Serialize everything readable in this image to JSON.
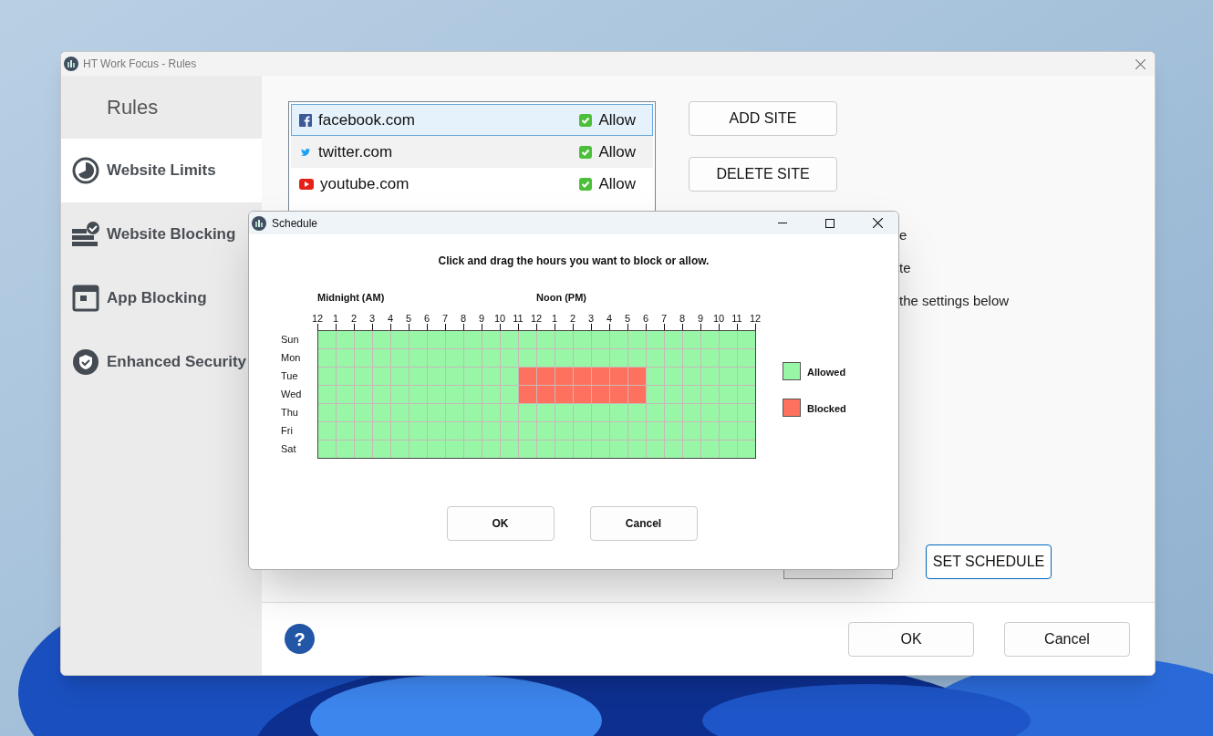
{
  "window": {
    "title": "HT Work Focus - Rules"
  },
  "sidebar": {
    "title": "Rules",
    "items": [
      {
        "label": "Website Limits",
        "selected": true
      },
      {
        "label": "Website Blocking",
        "selected": false
      },
      {
        "label": "App Blocking",
        "selected": false
      },
      {
        "label": "Enhanced Security",
        "selected": false
      }
    ]
  },
  "sites": [
    {
      "name": "facebook.com",
      "rule": "Allow",
      "selected": true
    },
    {
      "name": "twitter.com",
      "rule": "Allow",
      "selected": false
    },
    {
      "name": "youtube.com",
      "rule": "Allow",
      "selected": false
    }
  ],
  "site_buttons": [
    "ADD SITE",
    "DELETE SITE"
  ],
  "partial_texts": [
    "e",
    "te",
    "the settings below"
  ],
  "set_schedule_button": "SET SCHEDULE",
  "footer": {
    "help": "?",
    "buttons": [
      "OK",
      "Cancel"
    ]
  },
  "dialog": {
    "title": "Schedule",
    "instruction": "Click and drag the hours you want to block or allow.",
    "am_label": "Midnight (AM)",
    "pm_label": "Noon (PM)",
    "hours": [
      "12",
      "1",
      "2",
      "3",
      "4",
      "5",
      "6",
      "7",
      "8",
      "9",
      "10",
      "11",
      "12",
      "1",
      "2",
      "3",
      "4",
      "5",
      "6",
      "7",
      "8",
      "9",
      "10",
      "11",
      "12"
    ],
    "days": [
      {
        "label": "Sun",
        "blocked": [
          false,
          false,
          false,
          false,
          false,
          false,
          false,
          false,
          false,
          false,
          false,
          false,
          false,
          false,
          false,
          false,
          false,
          false,
          false,
          false,
          false,
          false,
          false,
          false
        ]
      },
      {
        "label": "Mon",
        "blocked": [
          false,
          false,
          false,
          false,
          false,
          false,
          false,
          false,
          false,
          false,
          false,
          false,
          false,
          false,
          false,
          false,
          false,
          false,
          false,
          false,
          false,
          false,
          false,
          false
        ]
      },
      {
        "label": "Tue",
        "blocked": [
          false,
          false,
          false,
          false,
          false,
          false,
          false,
          false,
          false,
          false,
          false,
          true,
          true,
          true,
          true,
          true,
          true,
          true,
          false,
          false,
          false,
          false,
          false,
          false
        ]
      },
      {
        "label": "Wed",
        "blocked": [
          false,
          false,
          false,
          false,
          false,
          false,
          false,
          false,
          false,
          false,
          false,
          true,
          true,
          true,
          true,
          true,
          true,
          true,
          false,
          false,
          false,
          false,
          false,
          false
        ]
      },
      {
        "label": "Thu",
        "blocked": [
          false,
          false,
          false,
          false,
          false,
          false,
          false,
          false,
          false,
          false,
          false,
          false,
          false,
          false,
          false,
          false,
          false,
          false,
          false,
          false,
          false,
          false,
          false,
          false
        ]
      },
      {
        "label": "Fri",
        "blocked": [
          false,
          false,
          false,
          false,
          false,
          false,
          false,
          false,
          false,
          false,
          false,
          false,
          false,
          false,
          false,
          false,
          false,
          false,
          false,
          false,
          false,
          false,
          false,
          false
        ]
      },
      {
        "label": "Sat",
        "blocked": [
          false,
          false,
          false,
          false,
          false,
          false,
          false,
          false,
          false,
          false,
          false,
          false,
          false,
          false,
          false,
          false,
          false,
          false,
          false,
          false,
          false,
          false,
          false,
          false
        ]
      }
    ],
    "legend": [
      {
        "label": "Allowed",
        "color": "#98f7a6"
      },
      {
        "label": "Blocked",
        "color": "#fe715e"
      }
    ],
    "buttons": [
      "OK",
      "Cancel"
    ]
  }
}
